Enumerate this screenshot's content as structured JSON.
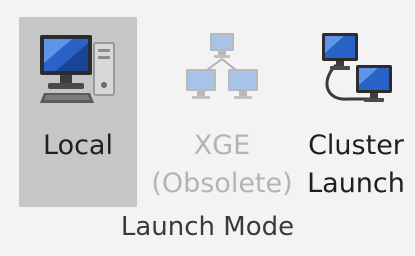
{
  "launch_mode": {
    "group_label": "Launch Mode",
    "buttons": [
      {
        "id": "local",
        "lines": [
          "Local"
        ],
        "icon": "local-computer-icon",
        "state": "selected"
      },
      {
        "id": "xge",
        "lines": [
          "XGE",
          "(Obsolete)"
        ],
        "icon": "network-computers-icon",
        "state": "disabled"
      },
      {
        "id": "cluster",
        "lines": [
          "Cluster",
          "Launch"
        ],
        "icon": "cluster-computers-icon",
        "state": "enabled"
      }
    ]
  },
  "colors": {
    "background": "#f3f3f3",
    "selected_background": "#c6c6c6",
    "disabled_text": "#b4b4b4",
    "text": "#1f1f1f"
  }
}
